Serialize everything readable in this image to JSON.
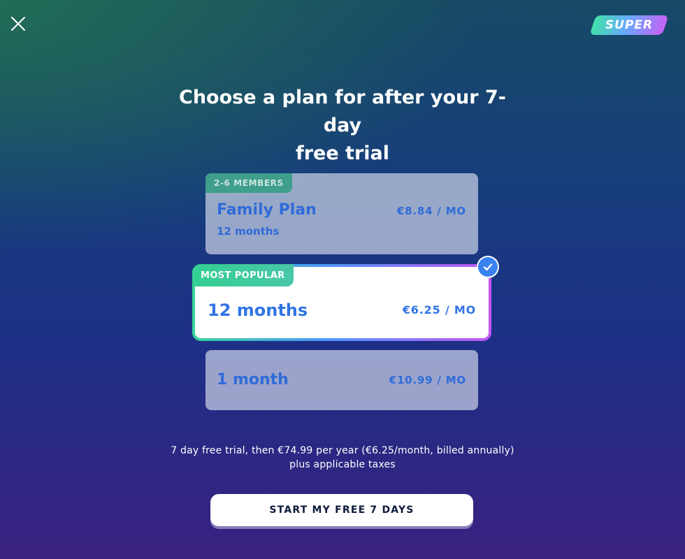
{
  "header": {
    "close_icon": "close-icon",
    "logo_text": "SUPER",
    "logo_colors": [
      "#3fe0a8",
      "#6aa8ff",
      "#c661f4"
    ]
  },
  "title": {
    "line1": "Choose a plan for after your 7-day",
    "line2": "free trial"
  },
  "plans": {
    "family": {
      "badge": "2-6 MEMBERS",
      "name": "Family Plan",
      "duration": "12 months",
      "price": "€8.84 / MO"
    },
    "yearly": {
      "badge": "MOST POPULAR",
      "name": "12 months",
      "price": "€6.25 / MO",
      "selected": true
    },
    "monthly": {
      "name": "1 month",
      "price": "€10.99 / MO"
    }
  },
  "disclaimer": {
    "line1": "7 day free trial, then €74.99 per year (€6.25/month, billed annually)",
    "line2": "plus applicable taxes"
  },
  "cta": {
    "label": "START MY FREE 7 DAYS"
  },
  "colors": {
    "accent_blue": "#3274e4",
    "popular_green": "#34cf92",
    "selected_border_end": "#c456f2"
  }
}
